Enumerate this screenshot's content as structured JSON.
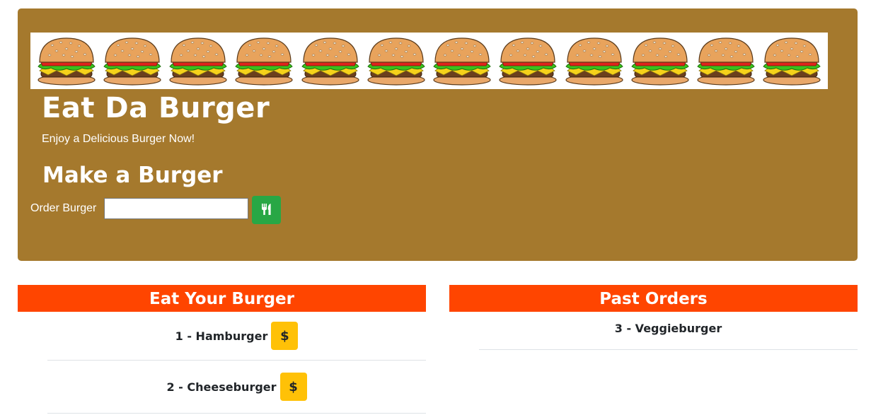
{
  "header": {
    "title": "Eat Da Burger",
    "tagline": "Enjoy a Delicious Burger Now!",
    "banner_burger_count": 12
  },
  "form": {
    "heading": "Make a Burger",
    "label": "Order Burger",
    "input_value": "",
    "input_placeholder": "",
    "submit_icon": "utensils-icon"
  },
  "colors": {
    "jumbotron": "#a5792d",
    "panel_header": "#ff4500",
    "submit_button": "#28a745",
    "devour_button": "#ffc107"
  },
  "eat_panel": {
    "heading": "Eat Your Burger",
    "items": [
      {
        "label": "1 - Hamburger",
        "button": "$"
      },
      {
        "label": "2 - Cheeseburger",
        "button": "$"
      }
    ]
  },
  "past_panel": {
    "heading": "Past Orders",
    "items": [
      {
        "label": "3 - Veggieburger"
      }
    ]
  }
}
